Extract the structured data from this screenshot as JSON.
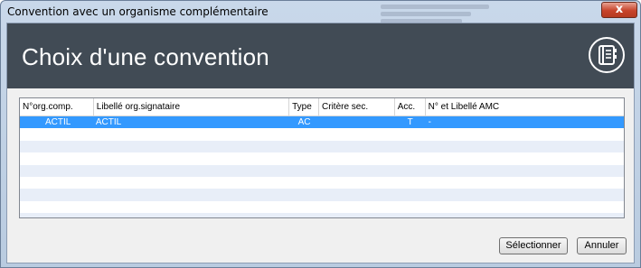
{
  "window": {
    "title": "Convention avec un organisme complémentaire",
    "close_label": "x"
  },
  "banner": {
    "title": "Choix d'une convention",
    "icon": "notebook-icon"
  },
  "table": {
    "columns": [
      "N°org.comp.",
      "Libellé org.signataire",
      "Type",
      "Critère sec.",
      "Acc.",
      "N° et Libellé AMC"
    ],
    "rows": [
      {
        "org_comp": "ACTIL",
        "libelle": "ACTIL",
        "type": "AC",
        "critere": "",
        "acc": "T",
        "amc": "-",
        "selected": true
      }
    ]
  },
  "buttons": {
    "select_label": "Sélectionner",
    "cancel_label": "Annuler"
  },
  "colors": {
    "banner_bg": "#414b55",
    "selection": "#3399ff",
    "close_button": "#c7432a"
  }
}
